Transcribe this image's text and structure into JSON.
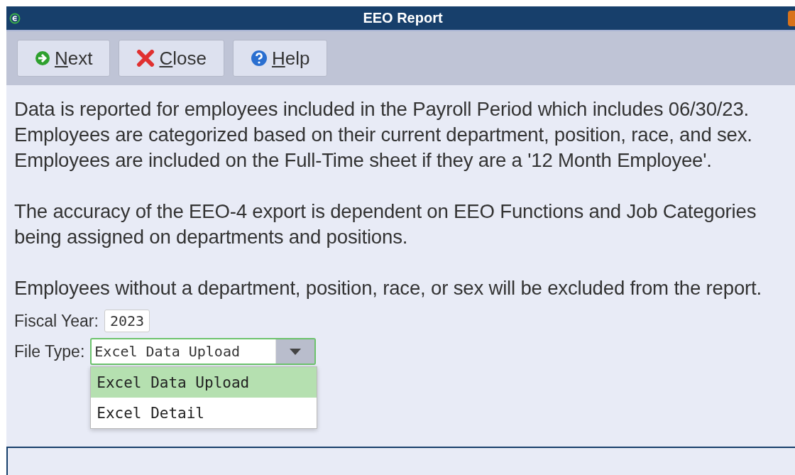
{
  "window": {
    "title": "EEO Report"
  },
  "toolbar": [
    {
      "label": "Next",
      "kind": "next"
    },
    {
      "label": "Close",
      "kind": "close"
    },
    {
      "label": "Help",
      "kind": "help"
    }
  ],
  "paragraphs": [
    "Data is reported for employees included in the Payroll Period which includes 06/30/23. Employees are categorized based on their current department, position, race, and sex. Employees are included on the Full-Time sheet if they are a '12 Month Employee'.",
    "The accuracy of the EEO-4 export is dependent on EEO Functions and Job Categories being assigned on departments and positions.",
    "Employees without a department, position, race, or sex will be excluded from the report."
  ],
  "fiscal_year": {
    "label": "Fiscal Year:",
    "value": "2023"
  },
  "file_type": {
    "label": "File Type:",
    "value": "Excel Data Upload",
    "expanded": true,
    "options": [
      {
        "label": "Excel Data Upload",
        "selected": true
      },
      {
        "label": "Excel Detail",
        "selected": false
      }
    ]
  }
}
